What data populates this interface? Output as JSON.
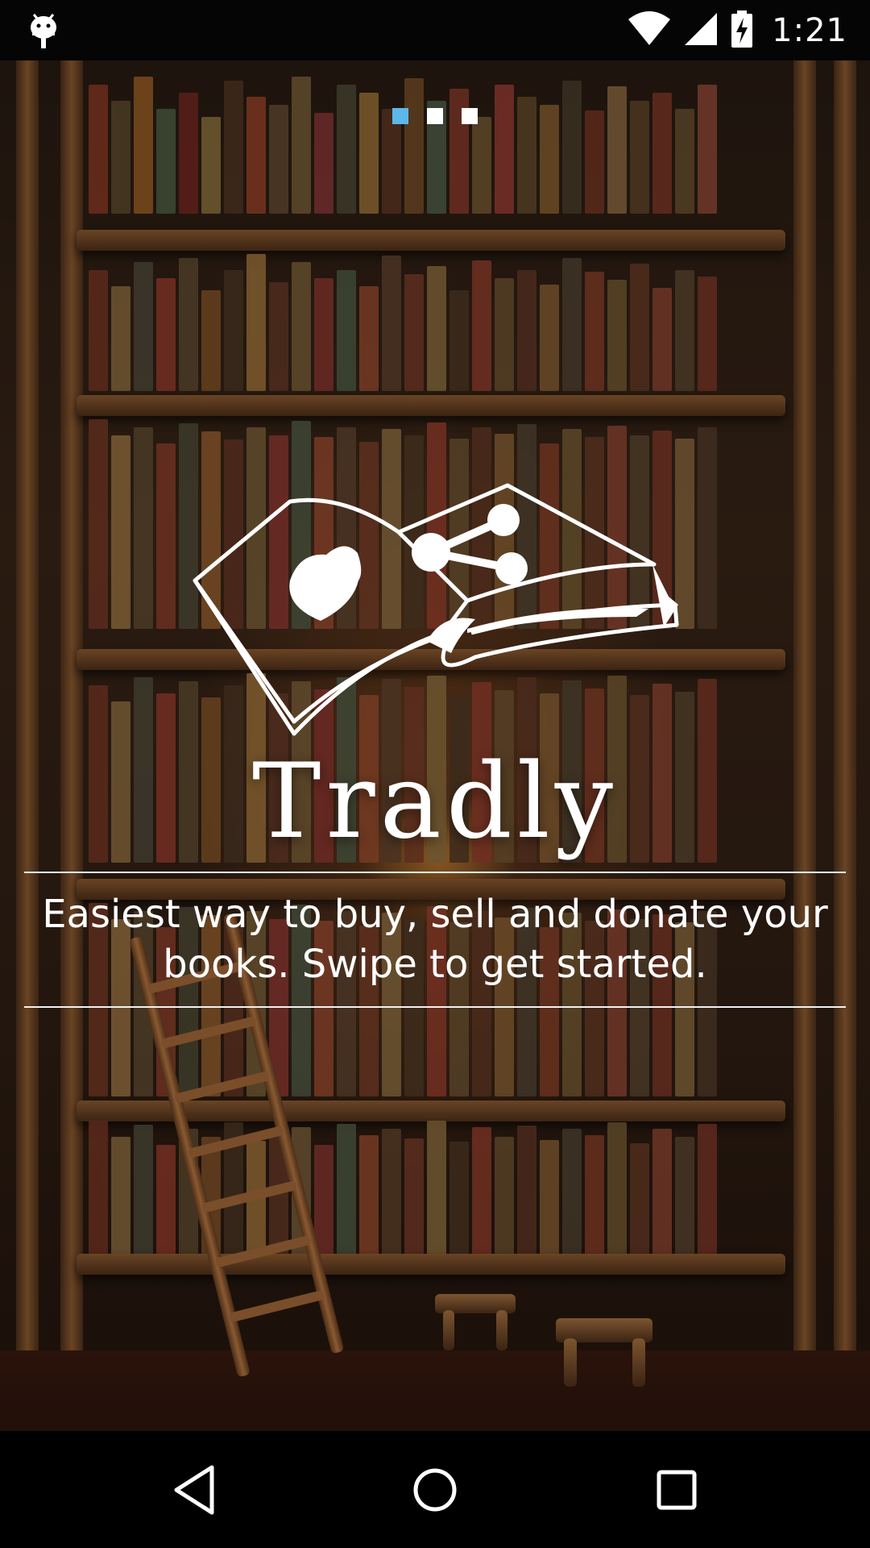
{
  "status_bar": {
    "time": "1:21",
    "icons": [
      "android-debug-icon",
      "wifi-icon",
      "cell-signal-icon",
      "battery-charging-icon"
    ]
  },
  "onboarding": {
    "page_indicator": {
      "total": 3,
      "active_index": 0,
      "active_color": "#5bb8e8",
      "inactive_color": "#ffffff"
    },
    "logo_icon": "open-book-heart-share-icon",
    "brand_name": "Tradly",
    "tagline": "Easiest way to buy, sell and donate your books. Swipe to get started."
  },
  "nav_bar": {
    "buttons": [
      "back-icon",
      "home-icon",
      "recents-icon"
    ]
  },
  "colors": {
    "text": "#ffffff",
    "accent": "#5bb8e8",
    "background": "#2a1b11",
    "bars": "#000000"
  }
}
